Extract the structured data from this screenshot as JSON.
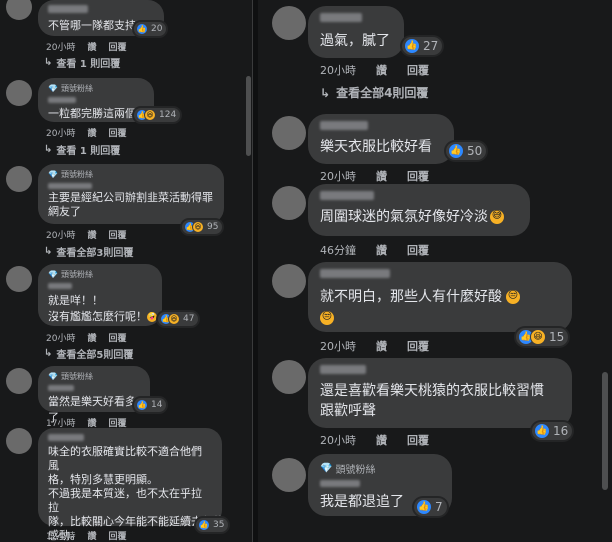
{
  "common": {
    "like_label": "讚",
    "reply_label": "回覆",
    "fan_badge": "頭號粉絲",
    "like_icon": "thumbs-up",
    "haha_icon": "laughing-face",
    "reply_arrow": "↳"
  },
  "left": {
    "comments": [
      {
        "text": "不管哪一隊都支持",
        "reactions": "20",
        "time": "20小時",
        "replies": "查看 1 則回覆"
      },
      {
        "badge": "頭號粉絲",
        "text": "一粒都完勝這兩個",
        "reactions": "124",
        "time": "20小時",
        "replies": "查看 1 則回覆"
      },
      {
        "badge": "頭號粉絲",
        "text": "主要是經紀公司辦割韭菜活動得罪網友了",
        "reactions": "95",
        "time": "20小時",
        "replies": "查看全部3則回覆"
      },
      {
        "badge": "頭號粉絲",
        "text_line1": "就是咩！！",
        "text_line2": "沒有尷尷怎麼行呢！",
        "reactions": "47",
        "time": "20小時",
        "replies": "查看全部5則回覆"
      },
      {
        "badge": "頭號粉絲",
        "text": "當然是樂天好看多了",
        "reactions": "14",
        "time": "17小時"
      },
      {
        "text_line1": "味全的衣服確實比較不適合他們風",
        "text_line2": "格，特別多慧更明顯。",
        "text_line3": "不過我是本質迷，也不太在乎拉拉",
        "text_line4": "隊，比較關心今年能不能延續去年的",
        "text_line5": "感動。",
        "reactions": "35",
        "time": "12小時"
      }
    ]
  },
  "right": {
    "comments": [
      {
        "text": "過氣，膩了",
        "reactions": "27",
        "time": "20小時",
        "replies": "查看全部4則回覆"
      },
      {
        "text": "樂天衣服比較好看",
        "reactions": "50",
        "time": "20小時"
      },
      {
        "text": "周圍球迷的氣氛好像好冷淡",
        "time": "46分鐘"
      },
      {
        "text": "就不明白，那些人有什麼好酸",
        "reactions": "15",
        "time": "20小時"
      },
      {
        "text_line1": "還是喜歡看樂天桃猿的衣服比較習慣",
        "text_line2": "跟歡呼聲",
        "reactions": "16",
        "time": "20小時"
      },
      {
        "badge": "頭號粉絲",
        "text": "我是都退追了",
        "reactions": "7"
      }
    ]
  }
}
